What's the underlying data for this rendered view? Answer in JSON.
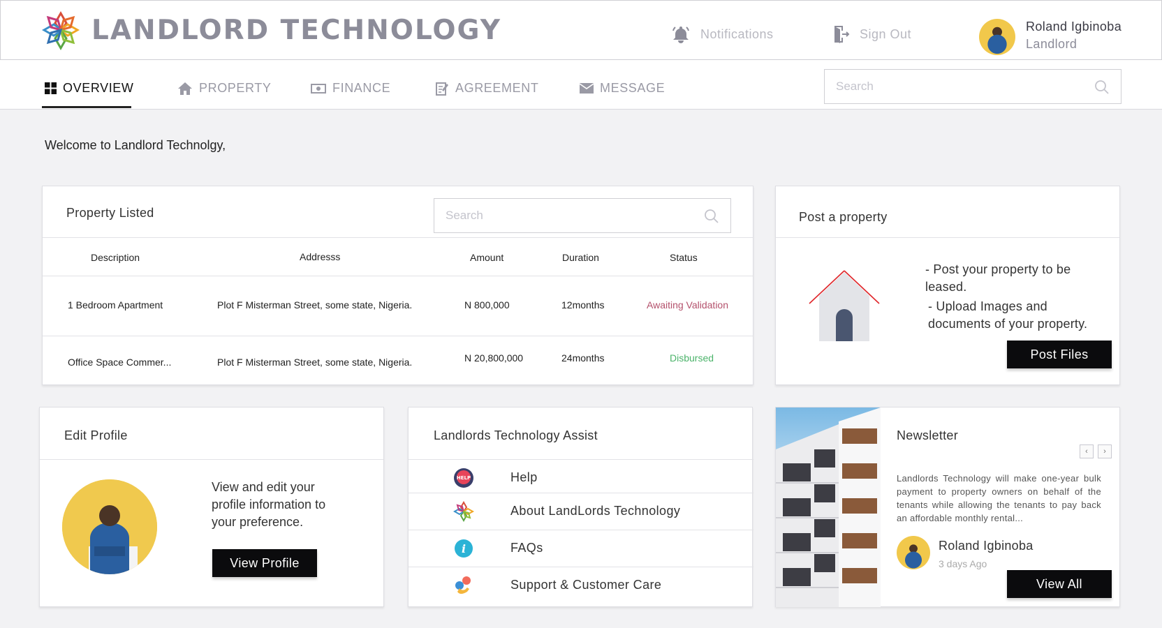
{
  "header": {
    "brand": "LANDLORD TECHNOLOGY",
    "notifications_label": "Notifications",
    "signout_label": "Sign Out",
    "user_name": "Roland Igbinoba",
    "user_role": "Landlord"
  },
  "nav": {
    "items": [
      {
        "label": "OVERVIEW",
        "icon": "grid-icon"
      },
      {
        "label": "PROPERTY",
        "icon": "home-icon"
      },
      {
        "label": "FINANCE",
        "icon": "money-icon"
      },
      {
        "label": "AGREEMENT",
        "icon": "document-edit-icon"
      },
      {
        "label": "MESSAGE",
        "icon": "envelope-icon"
      }
    ],
    "search_placeholder": "Search"
  },
  "welcome": "Welcome to Landlord Technolgy,",
  "property": {
    "title": "Property Listed",
    "search_placeholder": "Search",
    "columns": [
      "Description",
      "Addresss",
      "Amount",
      "Duration",
      "Status"
    ],
    "rows": [
      {
        "description": "1 Bedroom Apartment",
        "address": "Plot F Misterman Street, some state, Nigeria.",
        "amount": "N 800,000",
        "duration": "12months",
        "status": "Awaiting Validation"
      },
      {
        "description": "Office Space Commer...",
        "address": "Plot F Misterman Street, some state, Nigeria.",
        "amount": "N 20,800,000",
        "duration": "24months",
        "status": "Disbursed"
      }
    ]
  },
  "post": {
    "title": "Post a property",
    "line1": "- Post your property to be leased.",
    "line2": "- Upload Images and documents of your property.",
    "button": "Post Files"
  },
  "profile": {
    "title": "Edit Profile",
    "description": "View and edit your profile information to your preference.",
    "button": "View Profile"
  },
  "assist": {
    "title": "Landlords Technology Assist",
    "items": [
      {
        "label": "Help",
        "icon": "help-badge-icon"
      },
      {
        "label": "About LandLords Technology",
        "icon": "brand-flower-icon"
      },
      {
        "label": "FAQs",
        "icon": "info-icon"
      },
      {
        "label": "Support & Customer Care",
        "icon": "support-phone-icon"
      }
    ]
  },
  "newsletter": {
    "title": "Newsletter",
    "body": "Landlords Technology will make one-year bulk payment to property owners on behalf of the tenants while allowing the tenants to pay back an affordable monthly rental...",
    "author": "Roland Igbinoba",
    "time": "3 days Ago",
    "button": "View All"
  },
  "colors": {
    "accent_dark": "#0b0b0d",
    "status_awaiting": "#b4516c",
    "status_disbursed": "#4bb36a",
    "muted": "#9a9aa5"
  }
}
